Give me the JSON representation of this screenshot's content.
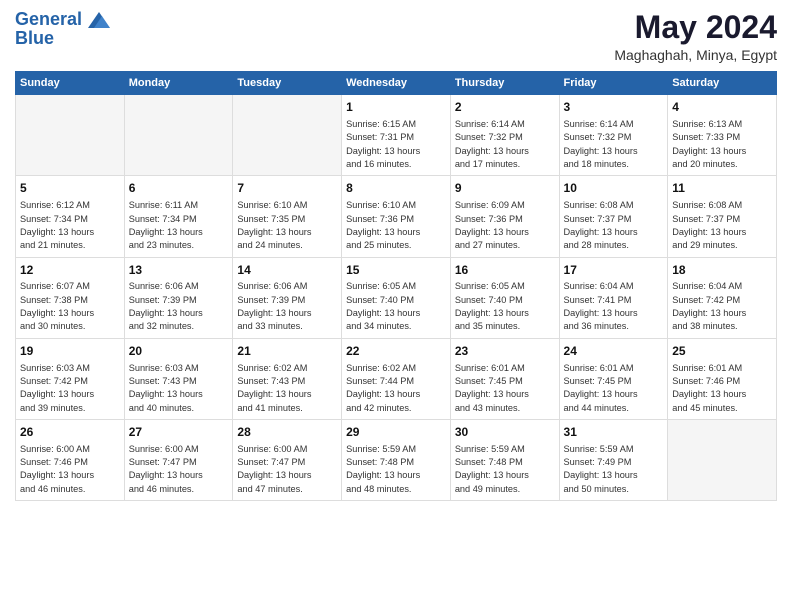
{
  "header": {
    "logo_line1": "General",
    "logo_line2": "Blue",
    "month": "May 2024",
    "location": "Maghaghah, Minya, Egypt"
  },
  "days_of_week": [
    "Sunday",
    "Monday",
    "Tuesday",
    "Wednesday",
    "Thursday",
    "Friday",
    "Saturday"
  ],
  "weeks": [
    [
      {
        "day": "",
        "info": ""
      },
      {
        "day": "",
        "info": ""
      },
      {
        "day": "",
        "info": ""
      },
      {
        "day": "1",
        "info": "Sunrise: 6:15 AM\nSunset: 7:31 PM\nDaylight: 13 hours\nand 16 minutes."
      },
      {
        "day": "2",
        "info": "Sunrise: 6:14 AM\nSunset: 7:32 PM\nDaylight: 13 hours\nand 17 minutes."
      },
      {
        "day": "3",
        "info": "Sunrise: 6:14 AM\nSunset: 7:32 PM\nDaylight: 13 hours\nand 18 minutes."
      },
      {
        "day": "4",
        "info": "Sunrise: 6:13 AM\nSunset: 7:33 PM\nDaylight: 13 hours\nand 20 minutes."
      }
    ],
    [
      {
        "day": "5",
        "info": "Sunrise: 6:12 AM\nSunset: 7:34 PM\nDaylight: 13 hours\nand 21 minutes."
      },
      {
        "day": "6",
        "info": "Sunrise: 6:11 AM\nSunset: 7:34 PM\nDaylight: 13 hours\nand 23 minutes."
      },
      {
        "day": "7",
        "info": "Sunrise: 6:10 AM\nSunset: 7:35 PM\nDaylight: 13 hours\nand 24 minutes."
      },
      {
        "day": "8",
        "info": "Sunrise: 6:10 AM\nSunset: 7:36 PM\nDaylight: 13 hours\nand 25 minutes."
      },
      {
        "day": "9",
        "info": "Sunrise: 6:09 AM\nSunset: 7:36 PM\nDaylight: 13 hours\nand 27 minutes."
      },
      {
        "day": "10",
        "info": "Sunrise: 6:08 AM\nSunset: 7:37 PM\nDaylight: 13 hours\nand 28 minutes."
      },
      {
        "day": "11",
        "info": "Sunrise: 6:08 AM\nSunset: 7:37 PM\nDaylight: 13 hours\nand 29 minutes."
      }
    ],
    [
      {
        "day": "12",
        "info": "Sunrise: 6:07 AM\nSunset: 7:38 PM\nDaylight: 13 hours\nand 30 minutes."
      },
      {
        "day": "13",
        "info": "Sunrise: 6:06 AM\nSunset: 7:39 PM\nDaylight: 13 hours\nand 32 minutes."
      },
      {
        "day": "14",
        "info": "Sunrise: 6:06 AM\nSunset: 7:39 PM\nDaylight: 13 hours\nand 33 minutes."
      },
      {
        "day": "15",
        "info": "Sunrise: 6:05 AM\nSunset: 7:40 PM\nDaylight: 13 hours\nand 34 minutes."
      },
      {
        "day": "16",
        "info": "Sunrise: 6:05 AM\nSunset: 7:40 PM\nDaylight: 13 hours\nand 35 minutes."
      },
      {
        "day": "17",
        "info": "Sunrise: 6:04 AM\nSunset: 7:41 PM\nDaylight: 13 hours\nand 36 minutes."
      },
      {
        "day": "18",
        "info": "Sunrise: 6:04 AM\nSunset: 7:42 PM\nDaylight: 13 hours\nand 38 minutes."
      }
    ],
    [
      {
        "day": "19",
        "info": "Sunrise: 6:03 AM\nSunset: 7:42 PM\nDaylight: 13 hours\nand 39 minutes."
      },
      {
        "day": "20",
        "info": "Sunrise: 6:03 AM\nSunset: 7:43 PM\nDaylight: 13 hours\nand 40 minutes."
      },
      {
        "day": "21",
        "info": "Sunrise: 6:02 AM\nSunset: 7:43 PM\nDaylight: 13 hours\nand 41 minutes."
      },
      {
        "day": "22",
        "info": "Sunrise: 6:02 AM\nSunset: 7:44 PM\nDaylight: 13 hours\nand 42 minutes."
      },
      {
        "day": "23",
        "info": "Sunrise: 6:01 AM\nSunset: 7:45 PM\nDaylight: 13 hours\nand 43 minutes."
      },
      {
        "day": "24",
        "info": "Sunrise: 6:01 AM\nSunset: 7:45 PM\nDaylight: 13 hours\nand 44 minutes."
      },
      {
        "day": "25",
        "info": "Sunrise: 6:01 AM\nSunset: 7:46 PM\nDaylight: 13 hours\nand 45 minutes."
      }
    ],
    [
      {
        "day": "26",
        "info": "Sunrise: 6:00 AM\nSunset: 7:46 PM\nDaylight: 13 hours\nand 46 minutes."
      },
      {
        "day": "27",
        "info": "Sunrise: 6:00 AM\nSunset: 7:47 PM\nDaylight: 13 hours\nand 46 minutes."
      },
      {
        "day": "28",
        "info": "Sunrise: 6:00 AM\nSunset: 7:47 PM\nDaylight: 13 hours\nand 47 minutes."
      },
      {
        "day": "29",
        "info": "Sunrise: 5:59 AM\nSunset: 7:48 PM\nDaylight: 13 hours\nand 48 minutes."
      },
      {
        "day": "30",
        "info": "Sunrise: 5:59 AM\nSunset: 7:48 PM\nDaylight: 13 hours\nand 49 minutes."
      },
      {
        "day": "31",
        "info": "Sunrise: 5:59 AM\nSunset: 7:49 PM\nDaylight: 13 hours\nand 50 minutes."
      },
      {
        "day": "",
        "info": ""
      }
    ]
  ]
}
